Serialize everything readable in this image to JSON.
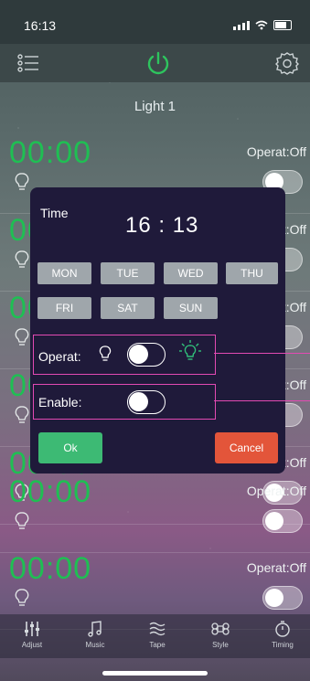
{
  "status": {
    "time": "16:13"
  },
  "header": {
    "title": "Light 1"
  },
  "rows": [
    {
      "time": "00:00",
      "operat": "Operat:Off"
    },
    {
      "time": "00:00",
      "operat": "Operat:Off"
    },
    {
      "time": "00:00",
      "operat": "Operat:Off"
    },
    {
      "time": "00:00",
      "operat": "Operat:Off"
    },
    {
      "time": "00:00",
      "operat": "Operat:Off"
    },
    {
      "time": "00:00",
      "operat": "Operat:Off"
    },
    {
      "time": "00:00",
      "operat": "Operat:Off"
    }
  ],
  "dialog": {
    "time_label": "Time",
    "time_value": "16 : 13",
    "days": [
      "MON",
      "TUE",
      "WED",
      "THU",
      "FRI",
      "SAT",
      "SUN"
    ],
    "operat_label": "Operat:",
    "enable_label": "Enable:",
    "ok_label": "Ok",
    "cancel_label": "Cancel"
  },
  "tabs": [
    {
      "label": "Adjust",
      "icon": "sliders-icon"
    },
    {
      "label": "Music",
      "icon": "music-icon"
    },
    {
      "label": "Tape",
      "icon": "tape-icon"
    },
    {
      "label": "Style",
      "icon": "style-icon"
    },
    {
      "label": "Timing",
      "icon": "timing-icon"
    }
  ],
  "colors": {
    "time_green": "#1fbf53",
    "ok": "#3dba74",
    "cancel": "#e3553a",
    "annotation": "#e24ab3"
  }
}
